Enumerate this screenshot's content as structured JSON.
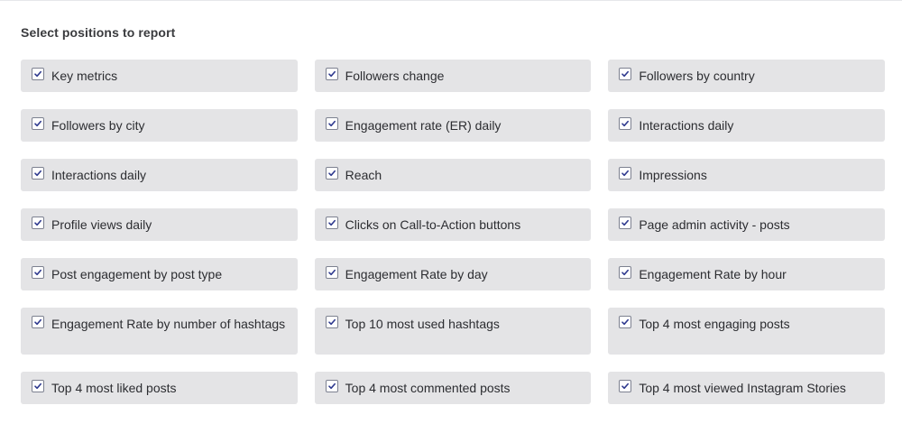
{
  "section_title": "Select positions to report",
  "rows": [
    [
      {
        "label": "Key metrics",
        "checked": true
      },
      {
        "label": "Followers change",
        "checked": true
      },
      {
        "label": "Followers by country",
        "checked": true
      }
    ],
    [
      {
        "label": "Followers by city",
        "checked": true
      },
      {
        "label": "Engagement rate (ER) daily",
        "checked": true
      },
      {
        "label": "Interactions daily",
        "checked": true
      }
    ],
    [
      {
        "label": "Interactions daily",
        "checked": true
      },
      {
        "label": "Reach",
        "checked": true
      },
      {
        "label": "Impressions",
        "checked": true
      }
    ],
    [
      {
        "label": "Profile views daily",
        "checked": true
      },
      {
        "label": "Clicks on Call-to-Action buttons",
        "checked": true
      },
      {
        "label": "Page admin activity - posts",
        "checked": true
      }
    ],
    [
      {
        "label": "Post engagement by post type",
        "checked": true
      },
      {
        "label": "Engagement Rate by day",
        "checked": true
      },
      {
        "label": "Engagement Rate by hour",
        "checked": true
      }
    ],
    [
      {
        "label": "Engagement Rate by number of hashtags",
        "checked": true
      },
      {
        "label": "Top 10 most used hashtags",
        "checked": true
      },
      {
        "label": "Top 4 most engaging posts",
        "checked": true
      }
    ],
    [
      {
        "label": "Top 4 most liked posts",
        "checked": true
      },
      {
        "label": "Top 4 most commented posts",
        "checked": true
      },
      {
        "label": "Top 4 most viewed Instagram Stories",
        "checked": true
      }
    ]
  ],
  "colors": {
    "option_background": "#e4e4e6",
    "checkmark": "#2f3a8f",
    "checkbox_border": "#7d8190"
  },
  "icons": {
    "checkbox": "checkmark-icon"
  }
}
